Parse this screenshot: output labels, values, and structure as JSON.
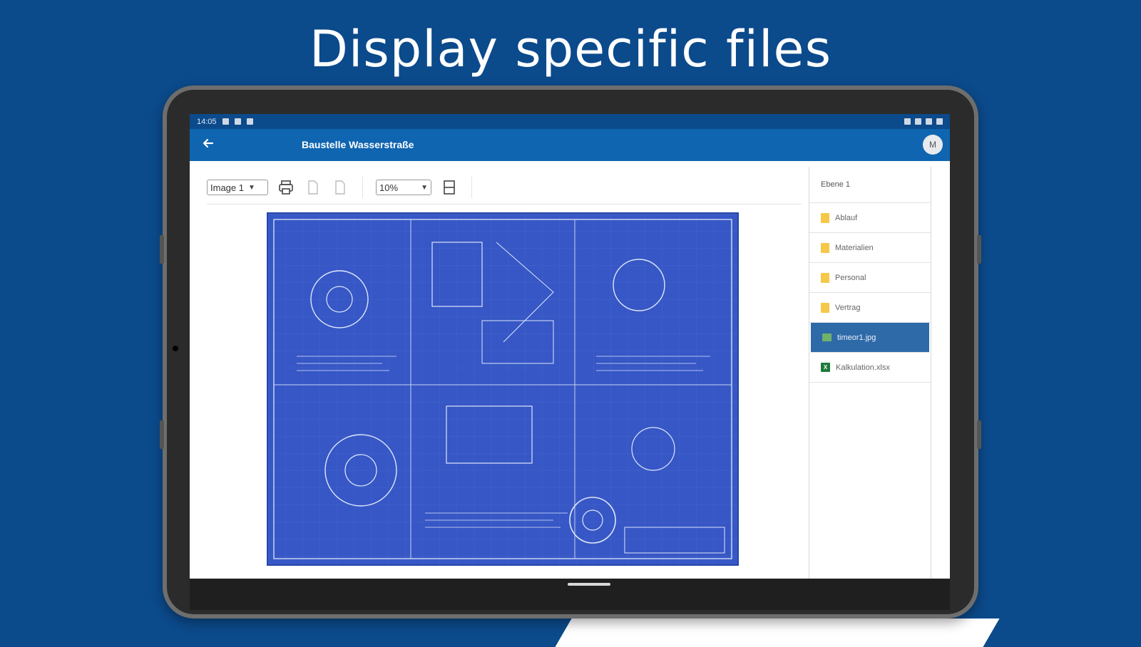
{
  "headline": "Display specific files",
  "status_bar": {
    "time": "14:05"
  },
  "appbar": {
    "title": "Baustelle Wasserstraße",
    "avatar_initial": "M"
  },
  "toolbar": {
    "image_select": {
      "value": "Image 1",
      "chevron": "chevron-down-icon"
    },
    "zoom_select": {
      "value": "10%",
      "chevron": "chevron-down-icon"
    },
    "icons": [
      "print-icon",
      "page-prev-icon",
      "page-next-icon",
      "fit-page-icon"
    ]
  },
  "filelist": {
    "header": "Ebene 1",
    "items": [
      {
        "label": "Ablauf",
        "icon": "folder-icon"
      },
      {
        "label": "Materialien",
        "icon": "folder-icon"
      },
      {
        "label": "Personal",
        "icon": "folder-icon"
      },
      {
        "label": "Vertrag",
        "icon": "folder-icon"
      },
      {
        "label": "timeor1.jpg",
        "icon": "image-file-icon",
        "selected": true
      },
      {
        "label": "Kalkulation.xlsx",
        "icon": "excel-file-icon"
      }
    ]
  },
  "colors": {
    "background": "#0b4a8b",
    "appbar": "#0f65b0",
    "blueprint": "#3657c5",
    "selected_row": "#2f6aa8"
  }
}
